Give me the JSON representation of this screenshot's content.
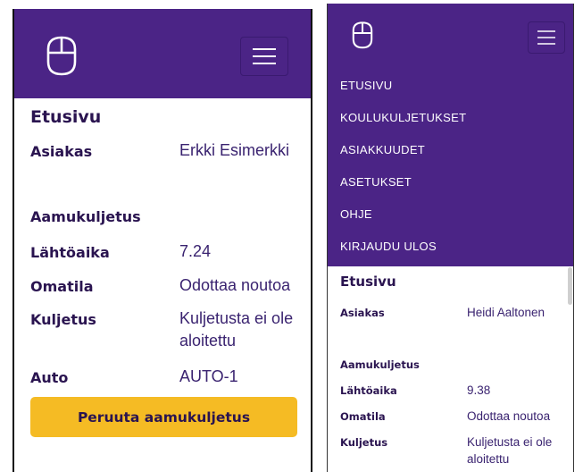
{
  "left": {
    "page_title": "Etusivu",
    "rows": [
      {
        "label": "Asiakas",
        "value": "Erkki Esimerkki"
      },
      {
        "label": "Lähtöaika",
        "value": "7.24"
      },
      {
        "label": "Omatila",
        "value": "Odottaa noutoa"
      },
      {
        "label": "Kuljetus",
        "value": "Kuljetusta ei ole aloitettu"
      },
      {
        "label": "Auto",
        "value": "AUTO-1"
      }
    ],
    "section_title": "Aamukuljetus",
    "cancel_button": "Peruuta aamukuljetus"
  },
  "right": {
    "nav": [
      "ETUSIVU",
      "KOULUKULJETUKSET",
      "ASIAKKUUDET",
      "ASETUKSET",
      "OHJE",
      "KIRJAUDU ULOS"
    ],
    "page_title": "Etusivu",
    "rows": [
      {
        "label": "Asiakas",
        "value": "Heidi Aaltonen"
      },
      {
        "label": "Lähtöaika",
        "value": "9.38"
      },
      {
        "label": "Omatila",
        "value": "Odottaa noutoa"
      },
      {
        "label": "Kuljetus",
        "value": "Kuljetusta ei ole aloitettu"
      }
    ],
    "section_title": "Aamukuljetus"
  },
  "colors": {
    "header_purple": "#4b2486",
    "text_dark_purple": "#2a1450",
    "button_yellow": "#f5bb24"
  },
  "icons": [
    "mouse-logo-icon",
    "hamburger-menu-icon"
  ]
}
